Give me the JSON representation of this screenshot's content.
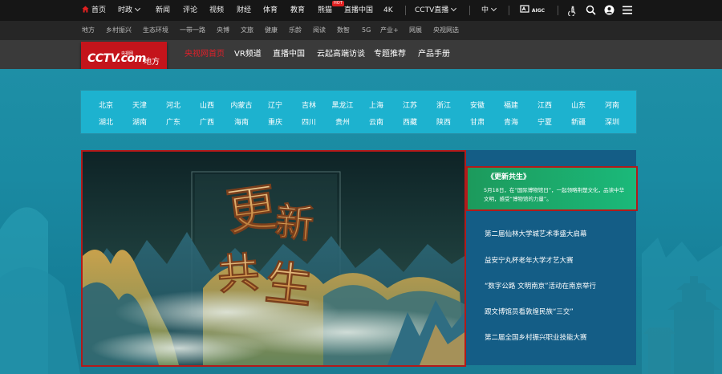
{
  "topnav": {
    "home": "首页",
    "items": [
      "时政",
      "新闻",
      "评论",
      "视频",
      "财经",
      "体育",
      "教育",
      "熊猫",
      "直播中国",
      "4K"
    ],
    "hot_badge": "HOT",
    "cctv_live": "CCTV直播",
    "lang": "中",
    "aigc": "AIGC"
  },
  "subnav": [
    "地方",
    "乡村振兴",
    "生态环境",
    "一带一路",
    "央博",
    "文旅",
    "健康",
    "乐龄",
    "阅读",
    "数智",
    "5G",
    "产业+",
    "网展",
    "央视网选"
  ],
  "brand": {
    "logo": "CCTV.com",
    "logo_small": "央视网",
    "region": "地方",
    "nav": [
      "央视网首页",
      "VR频道",
      "直播中国",
      "云起高端访谈",
      "专题推荐",
      "产品手册"
    ]
  },
  "cities": {
    "row1": [
      "北京",
      "天津",
      "河北",
      "山西",
      "内蒙古",
      "辽宁",
      "吉林",
      "黑龙江",
      "上海",
      "江苏",
      "浙江",
      "安徽",
      "福建",
      "江西",
      "山东",
      "河南"
    ],
    "row2": [
      "湖北",
      "湖南",
      "广东",
      "广西",
      "海南",
      "重庆",
      "四川",
      "贵州",
      "云南",
      "西藏",
      "陕西",
      "甘肃",
      "青海",
      "宁夏",
      "新疆",
      "深圳"
    ]
  },
  "feature": {
    "calligraphy": [
      "更",
      "新",
      "共",
      "生"
    ]
  },
  "side": {
    "title": "《更新共生》",
    "desc": "5月18日，在“国际博物馆日”，一起领略荆楚文化，品读中华文明，感受“博物馆的力量”。",
    "news": [
      "第二届仙林大学城艺术季盛大启幕",
      "益安宁丸杯老年大学才艺大赛",
      "“数字公路 文明南京”活动在南京举行",
      "跟文博馆员看敦煌民族“三交”",
      "第二届全国乡村振兴职业技能大赛"
    ]
  }
}
